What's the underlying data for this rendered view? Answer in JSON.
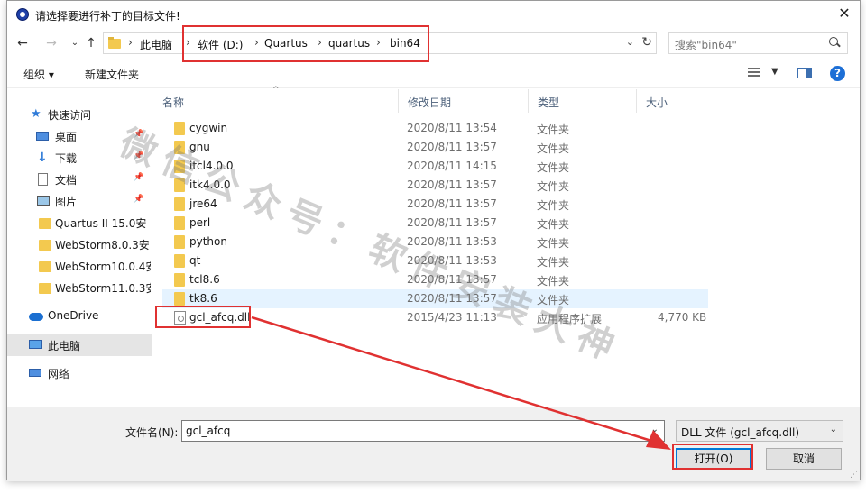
{
  "window": {
    "title": "请选择要进行补丁的目标文件!"
  },
  "nav": {
    "breadcrumbs": [
      "此电脑",
      "软件 (D:)",
      "Quartus",
      "quartus",
      "bin64"
    ],
    "search_placeholder": "搜索\"bin64\""
  },
  "toolbar": {
    "organize_label": "组织 ▾",
    "new_folder_label": "新建文件夹"
  },
  "sidebar": {
    "quick_access": "快速访问",
    "items": [
      {
        "label": "桌面",
        "icon": "desktop-icon"
      },
      {
        "label": "下载",
        "icon": "download-icon"
      },
      {
        "label": "文档",
        "icon": "document-icon"
      },
      {
        "label": "图片",
        "icon": "pictures-icon"
      },
      {
        "label": "Quartus II 15.0安",
        "icon": "folder-icon"
      },
      {
        "label": "WebStorm8.0.3安",
        "icon": "folder-icon"
      },
      {
        "label": "WebStorm10.0.4安",
        "icon": "folder-icon"
      },
      {
        "label": "WebStorm11.0.3安",
        "icon": "folder-icon"
      }
    ],
    "onedrive": "OneDrive",
    "this_pc": "此电脑",
    "network": "网络"
  },
  "columns": {
    "name": "名称",
    "date": "修改日期",
    "type": "类型",
    "size": "大小"
  },
  "files": [
    {
      "name": "cygwin",
      "date": "2020/8/11 13:54",
      "type": "文件夹",
      "size": ""
    },
    {
      "name": "gnu",
      "date": "2020/8/11 13:57",
      "type": "文件夹",
      "size": ""
    },
    {
      "name": "itcl4.0.0",
      "date": "2020/8/11 14:15",
      "type": "文件夹",
      "size": ""
    },
    {
      "name": "itk4.0.0",
      "date": "2020/8/11 13:57",
      "type": "文件夹",
      "size": ""
    },
    {
      "name": "jre64",
      "date": "2020/8/11 13:57",
      "type": "文件夹",
      "size": ""
    },
    {
      "name": "perl",
      "date": "2020/8/11 13:57",
      "type": "文件夹",
      "size": ""
    },
    {
      "name": "python",
      "date": "2020/8/11 13:53",
      "type": "文件夹",
      "size": ""
    },
    {
      "name": "qt",
      "date": "2020/8/11 13:53",
      "type": "文件夹",
      "size": ""
    },
    {
      "name": "tcl8.6",
      "date": "2020/8/11 13:57",
      "type": "文件夹",
      "size": ""
    },
    {
      "name": "tk8.6",
      "date": "2020/8/11 13:57",
      "type": "文件夹",
      "size": ""
    },
    {
      "name": "gcl_afcq.dll",
      "date": "2015/4/23 11:13",
      "type": "应用程序扩展",
      "size": "4,770 KB"
    }
  ],
  "watermark": "微信公众号：软件安装大神",
  "bottom": {
    "filename_label": "文件名(N):",
    "filename_value": "gcl_afcq",
    "filetype_value": "DLL 文件 (gcl_afcq.dll)",
    "open_label": "打开(O)",
    "cancel_label": "取消"
  },
  "colors": {
    "annotation": "#e03131",
    "accent": "#0078d7",
    "folder": "#f3c94f"
  }
}
